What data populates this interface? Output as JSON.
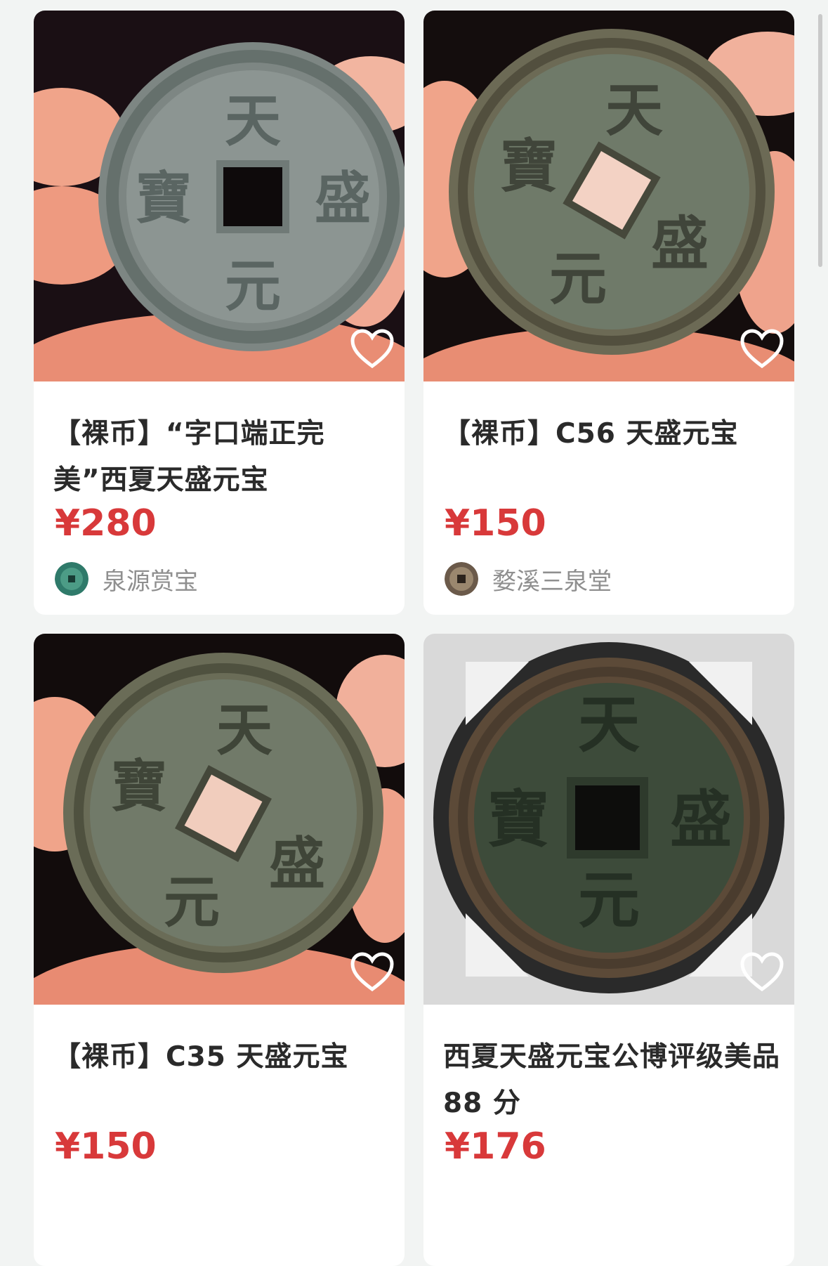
{
  "products": [
    {
      "title": "【裸币】“字口端正完美”西夏天盛元宝",
      "price": "¥280",
      "seller": "泉源赏宝",
      "image_icon": "coin-photo",
      "favorite_icon": "heart-icon"
    },
    {
      "title": "【裸币】C56 天盛元宝",
      "price": "¥150",
      "seller": "婺溪三泉堂",
      "image_icon": "coin-photo",
      "favorite_icon": "heart-icon"
    },
    {
      "title": "【裸币】C35 天盛元宝",
      "price": "¥150",
      "image_icon": "coin-photo",
      "favorite_icon": "heart-icon"
    },
    {
      "title": "西夏天盛元宝公博评级美品 88 分",
      "price": "¥176",
      "image_icon": "graded-coin-photo",
      "favorite_icon": "heart-icon"
    }
  ],
  "coin_inscription": {
    "top": "天",
    "right": "盛",
    "bottom": "元",
    "left": "寶"
  },
  "colors": {
    "price": "#d8393a",
    "background": "#f2f4f3",
    "seller_text": "#8f8f8f"
  }
}
